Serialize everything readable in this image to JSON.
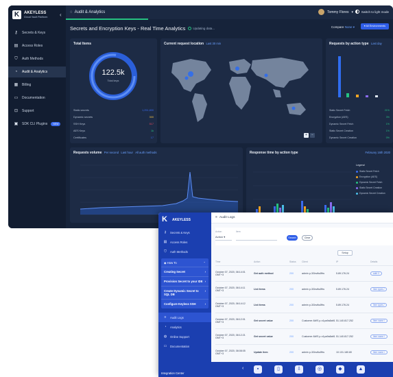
{
  "dash": {
    "logo": {
      "name": "AKEYLESS",
      "sub": "Cloud Vault Platform"
    },
    "nav": [
      {
        "label": "Secrets & Keys",
        "icon": "key-icon"
      },
      {
        "label": "Access Roles",
        "icon": "roles-icon"
      },
      {
        "label": "Auth Methods",
        "icon": "shield-icon"
      },
      {
        "label": "Audit & Analytics",
        "icon": "analytics-icon",
        "active": true
      },
      {
        "label": "Billing",
        "icon": "billing-icon"
      },
      {
        "label": "Documentation",
        "icon": "doc-icon"
      },
      {
        "label": "Support",
        "icon": "support-icon"
      },
      {
        "label": "SDK CLI Plugins",
        "icon": "plugin-icon",
        "badge": "NEW"
      }
    ],
    "breadcrumb": "Audit & Analytics",
    "user": "Tommy Flores",
    "theme_label": "Switch to light mode",
    "page_title": "Secrets and Encryption Keys - Real Time Analytics",
    "updating": "Updating data...",
    "compare_label": "Compare",
    "compare_value": "None",
    "env_button": "All Environments",
    "total": {
      "title": "Total Items",
      "value": "122.5k",
      "sub": "Total keys",
      "stats": [
        {
          "label": "Static secrets",
          "value": "1,251,800",
          "color": "#3b6cf0"
        },
        {
          "label": "Dynamic secrets",
          "value": "300",
          "color": "#f5c242"
        },
        {
          "label": "SSH Keys",
          "value": "517",
          "color": "#e84a5f"
        },
        {
          "label": "AES Keys",
          "value": "1k",
          "color": "#26c281"
        },
        {
          "label": "Certificates",
          "value": "17",
          "color": "#3b6cf0"
        }
      ]
    },
    "map": {
      "title": "Current request location",
      "link": "Last 30 min"
    },
    "action": {
      "title": "Requests by action type",
      "link": "Last day",
      "rows": [
        {
          "label": "Static Secret Fetch",
          "value": "21%"
        },
        {
          "label": "Encryption (AES)",
          "value": "3%"
        },
        {
          "label": "Dynamic Secret Fetch",
          "value": "1%"
        },
        {
          "label": "Static Secret Creation",
          "value": "1%"
        },
        {
          "label": "Dynamic Secret Creation",
          "value": "0%"
        }
      ]
    },
    "volume": {
      "title": "Requests volume",
      "per": "Per second",
      "range": "Last hour",
      "auth": "All auth methods"
    },
    "resp": {
      "title": "Response time by action type",
      "date": "February 16th 2020",
      "legend_title": "Legend",
      "legend": [
        {
          "label": "Static Secret Fetch",
          "color": "#3b6cf0"
        },
        {
          "label": "Encryption (AES)",
          "color": "#f5a623"
        },
        {
          "label": "Dynamic Secret Fetch",
          "color": "#26c281"
        },
        {
          "label": "Static Secret Creation",
          "color": "#8a6cf0"
        },
        {
          "label": "Dynamic Secret Creation",
          "color": "#4bc0e8"
        }
      ]
    }
  },
  "audit": {
    "logo": "AKEYLESS",
    "nav": [
      {
        "label": "Secrets & Keys"
      },
      {
        "label": "Access Roles"
      },
      {
        "label": "Auth Methods"
      }
    ],
    "help": {
      "title": "How To",
      "links": [
        "Creating Secret",
        "Provision Secret to your IDE",
        "Create Dynamic Secret to SQL DB",
        "Configure Keyless SSH"
      ]
    },
    "nav2": [
      {
        "label": "Audit Logs",
        "active": true
      },
      {
        "label": "Analytics"
      },
      {
        "label": "Online Support"
      },
      {
        "label": "Documentation"
      }
    ],
    "integration": "Integration Center",
    "top": "Audit Logs",
    "filters": {
      "action_label": "Action",
      "action_value": "Action",
      "item_label": "Item",
      "search": "Search",
      "clear": "Clear"
    },
    "setup": "Setup",
    "columns": [
      "Time",
      "Action",
      "Status",
      "Client",
      "IP",
      "Details"
    ],
    "rows": [
      {
        "time": "October 07, 2020, 08:14:01 GMT+3",
        "action": "Get auth method",
        "status": "200",
        "client": "admin p-3i3xv6s4ffru",
        "ip": "5.89.176.24",
        "detail": "auth //"
      },
      {
        "time": "October 07, 2020, 08:14:11 GMT+3",
        "action": "List items",
        "status": "200",
        "client": "admin p-3i3xv6s4ffru",
        "ip": "5.89.176.24",
        "detail": "Item types /"
      },
      {
        "time": "October 07, 2020, 08:14:12 GMT+3",
        "action": "List items",
        "status": "200",
        "client": "admin p-3i3xv6s4ffru",
        "ip": "5.89.176.24",
        "detail": "Item types /"
      },
      {
        "time": "October 07, 2020, 08:12:01 GMT+3",
        "action": "Get secret value",
        "status": "200",
        "client": "Customer AWS p-n1pa9a8aft1",
        "ip": "51.140.817.252",
        "detail": "Item name /"
      },
      {
        "time": "October 07, 2020, 08:12:21 GMT+3",
        "action": "Get secret value",
        "status": "200",
        "client": "Customer AWS p-n1pa9a8aft1",
        "ip": "51.140.817.252",
        "detail": "Item name /"
      },
      {
        "time": "October 07, 2020, 08:08:05 GMT+3",
        "action": "Update item",
        "status": "200",
        "client": "admin p-3i3xv6s4ffru",
        "ip": "10.131.180.80",
        "detail": "Item name /"
      }
    ]
  }
}
